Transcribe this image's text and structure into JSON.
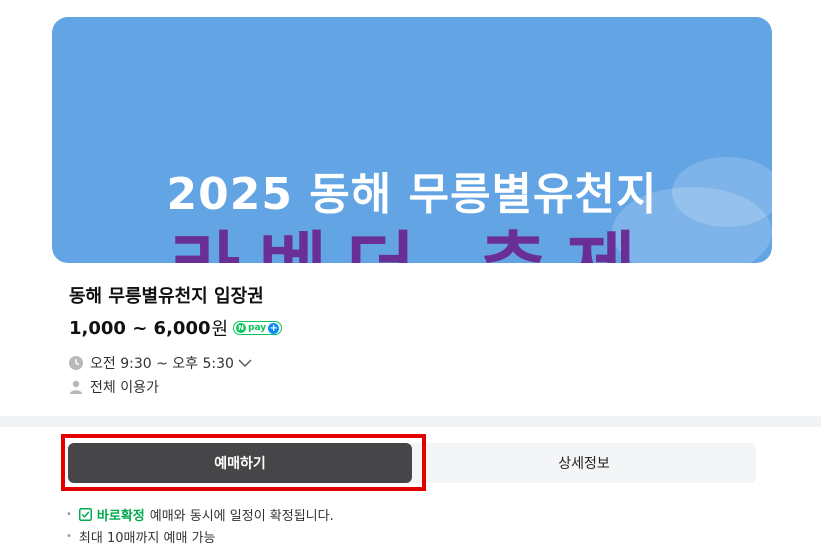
{
  "banner": {
    "title": "2025 동해 무릉별유천지",
    "subtitle": "라벤더 축제",
    "colors": {
      "background": "#62a4e4",
      "subtitle": "#6a2f96"
    }
  },
  "product": {
    "title": "동해 무릉별유천지 입장권",
    "price": "1,000 ~ 6,000",
    "price_unit": "원",
    "npay": {
      "n": "N",
      "text": "pay",
      "plus": "+"
    }
  },
  "info": {
    "time": "오전 9:30 ~ 오후 5:30",
    "time_icon": "clock-icon",
    "time_toggle_icon": "chevron-down-icon",
    "age": "전체 이용가",
    "age_icon": "person-icon"
  },
  "tabs": {
    "active": "예매하기",
    "inactive": "상세정보"
  },
  "notes": {
    "confirm_label": "바로확정",
    "confirm_text": "예매와 동시에 일정이 확정됩니다.",
    "limit_text": "최대 10매까지 예매 가능"
  },
  "colors": {
    "accent_green": "#03c75a",
    "active_tab": "#464648",
    "highlight": "#e50000"
  }
}
